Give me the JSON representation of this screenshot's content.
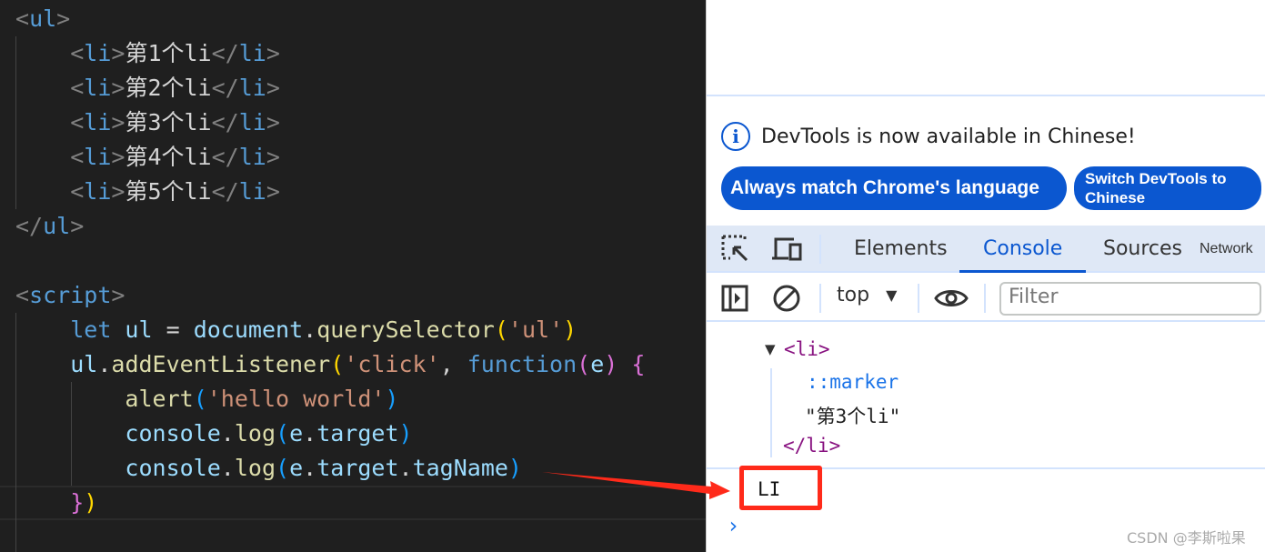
{
  "editor": {
    "lines": [
      [
        {
          "t": "<",
          "c": "br"
        },
        {
          "t": "ul",
          "c": "tag"
        },
        {
          "t": ">",
          "c": "br"
        }
      ],
      [
        {
          "t": "    ",
          "c": "txt"
        },
        {
          "t": "<",
          "c": "br"
        },
        {
          "t": "li",
          "c": "tag"
        },
        {
          "t": ">",
          "c": "br"
        },
        {
          "t": "第1个li",
          "c": "txt"
        },
        {
          "t": "</",
          "c": "br"
        },
        {
          "t": "li",
          "c": "tag"
        },
        {
          "t": ">",
          "c": "br"
        }
      ],
      [
        {
          "t": "    ",
          "c": "txt"
        },
        {
          "t": "<",
          "c": "br"
        },
        {
          "t": "li",
          "c": "tag"
        },
        {
          "t": ">",
          "c": "br"
        },
        {
          "t": "第2个li",
          "c": "txt"
        },
        {
          "t": "</",
          "c": "br"
        },
        {
          "t": "li",
          "c": "tag"
        },
        {
          "t": ">",
          "c": "br"
        }
      ],
      [
        {
          "t": "    ",
          "c": "txt"
        },
        {
          "t": "<",
          "c": "br"
        },
        {
          "t": "li",
          "c": "tag"
        },
        {
          "t": ">",
          "c": "br"
        },
        {
          "t": "第3个li",
          "c": "txt"
        },
        {
          "t": "</",
          "c": "br"
        },
        {
          "t": "li",
          "c": "tag"
        },
        {
          "t": ">",
          "c": "br"
        }
      ],
      [
        {
          "t": "    ",
          "c": "txt"
        },
        {
          "t": "<",
          "c": "br"
        },
        {
          "t": "li",
          "c": "tag"
        },
        {
          "t": ">",
          "c": "br"
        },
        {
          "t": "第4个li",
          "c": "txt"
        },
        {
          "t": "</",
          "c": "br"
        },
        {
          "t": "li",
          "c": "tag"
        },
        {
          "t": ">",
          "c": "br"
        }
      ],
      [
        {
          "t": "    ",
          "c": "txt"
        },
        {
          "t": "<",
          "c": "br"
        },
        {
          "t": "li",
          "c": "tag"
        },
        {
          "t": ">",
          "c": "br"
        },
        {
          "t": "第5个li",
          "c": "txt"
        },
        {
          "t": "</",
          "c": "br"
        },
        {
          "t": "li",
          "c": "tag"
        },
        {
          "t": ">",
          "c": "br"
        }
      ],
      [
        {
          "t": "</",
          "c": "br"
        },
        {
          "t": "ul",
          "c": "tag"
        },
        {
          "t": ">",
          "c": "br"
        }
      ],
      [],
      [
        {
          "t": "<",
          "c": "br"
        },
        {
          "t": "script",
          "c": "tag"
        },
        {
          "t": ">",
          "c": "br"
        }
      ],
      [
        {
          "t": "    ",
          "c": "txt"
        },
        {
          "t": "let",
          "c": "kw"
        },
        {
          "t": " ul ",
          "c": "var"
        },
        {
          "t": "=",
          "c": "op"
        },
        {
          "t": " document",
          "c": "var"
        },
        {
          "t": ".",
          "c": "op"
        },
        {
          "t": "querySelector",
          "c": "fn"
        },
        {
          "t": "(",
          "c": "p1"
        },
        {
          "t": "'ul'",
          "c": "str"
        },
        {
          "t": ")",
          "c": "p1"
        }
      ],
      [
        {
          "t": "    ",
          "c": "txt"
        },
        {
          "t": "ul",
          "c": "var"
        },
        {
          "t": ".",
          "c": "op"
        },
        {
          "t": "addEventListener",
          "c": "fn"
        },
        {
          "t": "(",
          "c": "p1"
        },
        {
          "t": "'click'",
          "c": "str"
        },
        {
          "t": ", ",
          "c": "op"
        },
        {
          "t": "function",
          "c": "kw"
        },
        {
          "t": "(",
          "c": "p2"
        },
        {
          "t": "e",
          "c": "var"
        },
        {
          "t": ")",
          "c": "p2"
        },
        {
          "t": " ",
          "c": "op"
        },
        {
          "t": "{",
          "c": "p2"
        }
      ],
      [
        {
          "t": "        ",
          "c": "txt"
        },
        {
          "t": "alert",
          "c": "fn"
        },
        {
          "t": "(",
          "c": "p3"
        },
        {
          "t": "'hello world'",
          "c": "str"
        },
        {
          "t": ")",
          "c": "p3"
        }
      ],
      [
        {
          "t": "        ",
          "c": "txt"
        },
        {
          "t": "console",
          "c": "var"
        },
        {
          "t": ".",
          "c": "op"
        },
        {
          "t": "log",
          "c": "fn"
        },
        {
          "t": "(",
          "c": "p3"
        },
        {
          "t": "e",
          "c": "var"
        },
        {
          "t": ".",
          "c": "op"
        },
        {
          "t": "target",
          "c": "var"
        },
        {
          "t": ")",
          "c": "p3"
        }
      ],
      [
        {
          "t": "        ",
          "c": "txt"
        },
        {
          "t": "console",
          "c": "var"
        },
        {
          "t": ".",
          "c": "op"
        },
        {
          "t": "log",
          "c": "fn"
        },
        {
          "t": "(",
          "c": "p3"
        },
        {
          "t": "e",
          "c": "var"
        },
        {
          "t": ".",
          "c": "op"
        },
        {
          "t": "target",
          "c": "var"
        },
        {
          "t": ".",
          "c": "op"
        },
        {
          "t": "tagName",
          "c": "var"
        },
        {
          "t": ")",
          "c": "p3"
        }
      ],
      [
        {
          "t": "    ",
          "c": "txt"
        },
        {
          "t": "}",
          "c": "p2"
        },
        {
          "t": ")",
          "c": "p1"
        }
      ]
    ]
  },
  "devtools": {
    "banner_text": "DevTools is now available in Chinese!",
    "info_icon": "i",
    "btn_match": "Always match Chrome's language",
    "btn_switch": "Switch DevTools to Chinese",
    "tabs": [
      "Elements",
      "Console",
      "Sources",
      "Network"
    ],
    "active_tab": "Console",
    "context": "top",
    "filter_placeholder": "Filter",
    "console": {
      "open_tag": "<li>",
      "marker": "::marker",
      "text_node": "\"第3个li\"",
      "close_tag": "</li>",
      "output": "LI",
      "prompt": "›"
    }
  },
  "annotation_color": "#ff2a1a",
  "watermark": "CSDN @李斯啦果"
}
